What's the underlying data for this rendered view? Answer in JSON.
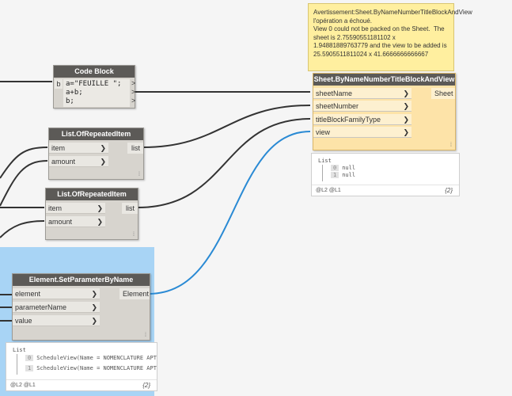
{
  "warning": {
    "text": "Avertissement:Sheet.ByNameNumberTitleBlockAndView l'opération a échoué.\nView 0 could not be packed on the Sheet.  The sheet is 2.75590551181102 x 1.94881889763779 and the view to be added is 25.5905511811024 x 41.6666666666667"
  },
  "code_block": {
    "title": "Code Block",
    "input_port": "b",
    "lines": [
      "a=\"FEUILLE \";",
      "a+b;",
      "b;"
    ],
    "outputs": [
      ">",
      ">",
      ">"
    ]
  },
  "repeat1": {
    "title": "List.OfRepeatedItem",
    "inputs": [
      "item",
      "amount"
    ],
    "output": "list"
  },
  "repeat2": {
    "title": "List.OfRepeatedItem",
    "inputs": [
      "item",
      "amount"
    ],
    "output": "list"
  },
  "sheet_node": {
    "title": "Sheet.ByNameNumberTitleBlockAndView",
    "inputs": [
      "sheetName",
      "sheetNumber",
      "titleBlockFamilyType",
      "view"
    ],
    "output": "Sheet"
  },
  "sheet_preview": {
    "title": "List",
    "items": [
      {
        "index": "0",
        "value": "null"
      },
      {
        "index": "1",
        "value": "null"
      }
    ],
    "levels": "@L2 @L1",
    "count": "{2}"
  },
  "setparam_node": {
    "title": "Element.SetParameterByName",
    "inputs": [
      "element",
      "parameterName",
      "value"
    ],
    "output": "Element"
  },
  "setparam_preview": {
    "title": "List",
    "items": [
      {
        "index": "0",
        "value": "ScheduleView(Name = NOMENCLATURE APT:"
      },
      {
        "index": "1",
        "value": "ScheduleView(Name = NOMENCLATURE APT:"
      }
    ],
    "levels": "@L2 @L1",
    "count": "{2}"
  },
  "chevron": "❯",
  "grip": "⁞",
  "colors": {
    "wire": "#333333",
    "selected_wire": "#2a8ad4",
    "selection": "#a8d4f5",
    "warning": "#ffef9f",
    "header": "#5c5a57"
  }
}
